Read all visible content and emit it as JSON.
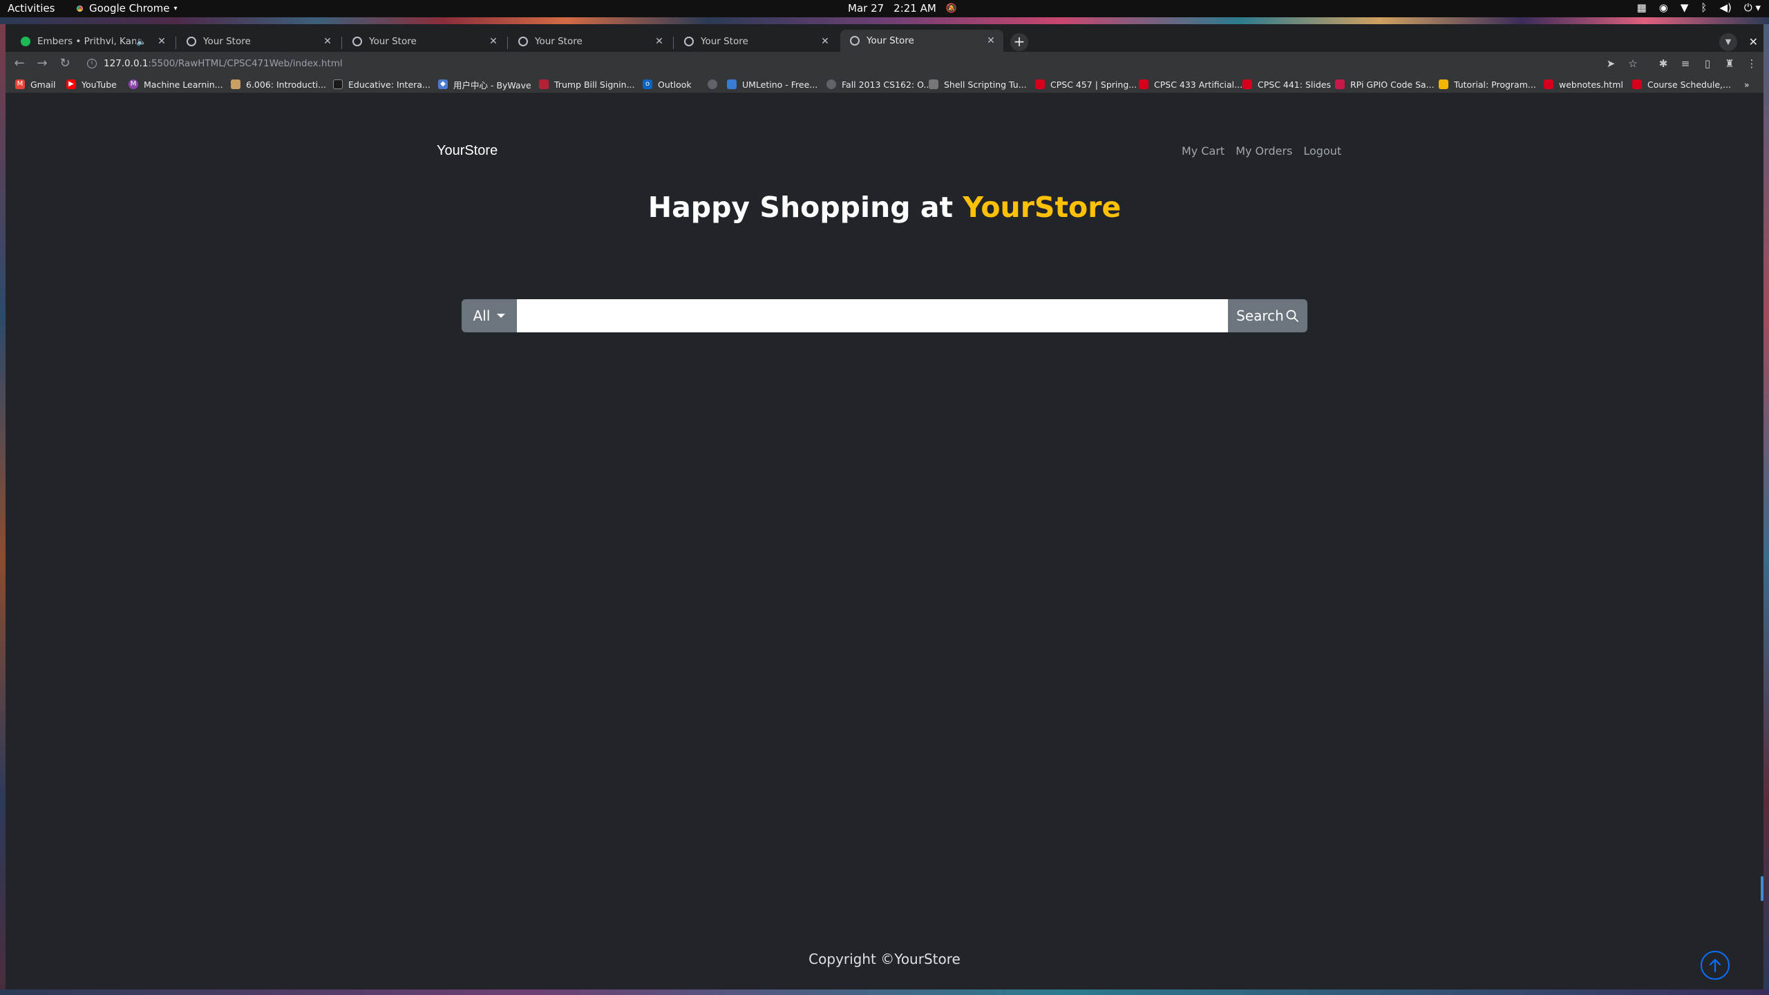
{
  "system_bar": {
    "activities": "Activities",
    "app_name": "Google Chrome",
    "date": "Mar 27",
    "time": "2:21 AM"
  },
  "browser": {
    "tabs": [
      {
        "title": "Embers • Prithvi, Kanisan",
        "audio": true,
        "active": false
      },
      {
        "title": "Your Store",
        "active": false
      },
      {
        "title": "Your Store",
        "active": false
      },
      {
        "title": "Your Store",
        "active": false
      },
      {
        "title": "Your Store",
        "active": false
      },
      {
        "title": "Your Store",
        "active": true
      }
    ],
    "url_host": "127.0.0.1",
    "url_rest": ":5500/RawHTML/CPSC471Web/index.html",
    "bookmarks": [
      {
        "label": "Gmail",
        "icon": "gmail-icon",
        "color": "#ea4335"
      },
      {
        "label": "YouTube",
        "icon": "youtube-icon",
        "color": "#ff0000"
      },
      {
        "label": "Machine Learnin...",
        "icon": "m-icon",
        "color": "#8e44ad"
      },
      {
        "label": "6.006: Introducti...",
        "icon": "ocw-icon",
        "color": "#c8a060"
      },
      {
        "label": "Educative: Intera...",
        "icon": "educative-icon",
        "color": "#1a1a1a"
      },
      {
        "label": "用户中心 - ByWave",
        "icon": "bywave-icon",
        "color": "#4a7bd0"
      },
      {
        "label": "Trump Bill Signin...",
        "icon": "news-icon",
        "color": "#b22234"
      },
      {
        "label": "Outlook",
        "icon": "outlook-icon",
        "color": "#0a66c2"
      },
      {
        "label": "",
        "icon": "globe-icon",
        "color": "#5f6368"
      },
      {
        "label": "UMLetino - Free...",
        "icon": "umletino-icon",
        "color": "#3a7bd5"
      },
      {
        "label": "Fall 2013 CS162: O...",
        "icon": "globe-icon",
        "color": "#5f6368"
      },
      {
        "label": "Shell Scripting Tu...",
        "icon": "shell-icon",
        "color": "#777777"
      },
      {
        "label": "CPSC 457 | Spring...",
        "icon": "ucalgary-icon",
        "color": "#d6001c"
      },
      {
        "label": "CPSC 433 Artificial...",
        "icon": "ucalgary-icon",
        "color": "#d6001c"
      },
      {
        "label": "CPSC 441: Slides",
        "icon": "ucalgary-icon",
        "color": "#d6001c"
      },
      {
        "label": "RPi GPIO Code Sa...",
        "icon": "rpi-icon",
        "color": "#c51a4a"
      },
      {
        "label": "Tutorial: Program...",
        "icon": "tutorial-icon",
        "color": "#f4b400"
      },
      {
        "label": "webnotes.html",
        "icon": "ucalgary-icon",
        "color": "#d6001c"
      },
      {
        "label": "Course Schedule,...",
        "icon": "ucalgary-icon",
        "color": "#d6001c"
      }
    ]
  },
  "site": {
    "brand": "YourStore",
    "nav": {
      "cart": "My Cart",
      "orders": "My Orders",
      "logout": "Logout"
    },
    "hero": {
      "prefix": "Happy Shopping at ",
      "accent": "YourStore",
      "accent_color": "#ffc107"
    },
    "search": {
      "category": "All",
      "value": "",
      "placeholder": "",
      "button_label": "Search"
    },
    "footer": "Copyright ©YourStore"
  }
}
